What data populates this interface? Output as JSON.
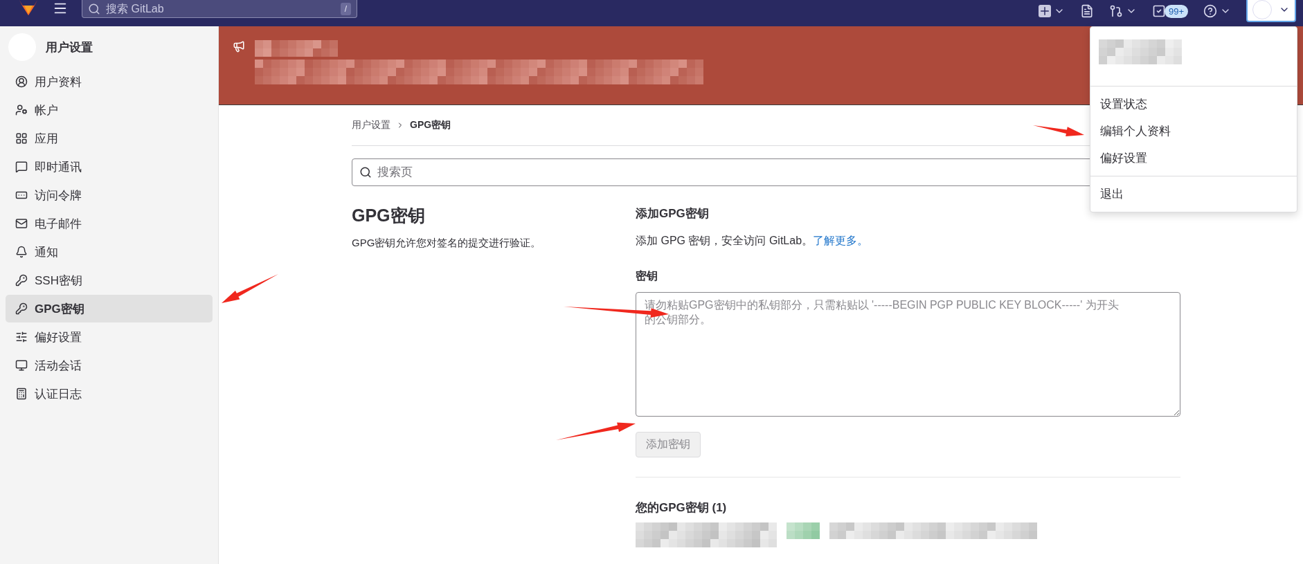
{
  "topbar": {
    "search": {
      "placeholder": "搜索 GitLab"
    },
    "shortcut": "/",
    "todo_count": "99+"
  },
  "sidebar": {
    "title": "用户设置",
    "items": [
      {
        "label": "用户资料",
        "selected": false
      },
      {
        "label": "帐户",
        "selected": false
      },
      {
        "label": "应用",
        "selected": false
      },
      {
        "label": "即时通讯",
        "selected": false
      },
      {
        "label": "访问令牌",
        "selected": false
      },
      {
        "label": "电子邮件",
        "selected": false
      },
      {
        "label": "通知",
        "selected": false
      },
      {
        "label": "SSH密钥",
        "selected": false
      },
      {
        "label": "GPG密钥",
        "selected": true
      },
      {
        "label": "偏好设置",
        "selected": false
      },
      {
        "label": "活动会话",
        "selected": false
      },
      {
        "label": "认证日志",
        "selected": false
      }
    ]
  },
  "breadcrumb": [
    "用户设置",
    "GPG密钥"
  ],
  "page_search": {
    "placeholder": "搜索页"
  },
  "section": {
    "title": "GPG密钥",
    "description": "GPG密钥允许您对签名的提交进行验证。"
  },
  "add_form": {
    "heading": "添加GPG密钥",
    "intro": "添加 GPG 密钥，安全访问 GitLab。",
    "link": "了解更多。",
    "key_label": "密钥",
    "key_placeholder": "请勿粘贴GPG密钥中的私钥部分，只需粘贴以 '-----BEGIN PGP PUBLIC KEY BLOCK-----' 为开头的公钥部分。",
    "submit": {
      "label": "添加密钥",
      "disabled": true
    }
  },
  "keys_list": {
    "heading": "您的GPG密钥 (1)"
  },
  "user_menu": {
    "groups": [
      [
        "设置状态",
        "编辑个人资料",
        "偏好设置"
      ],
      [
        "退出"
      ]
    ]
  }
}
